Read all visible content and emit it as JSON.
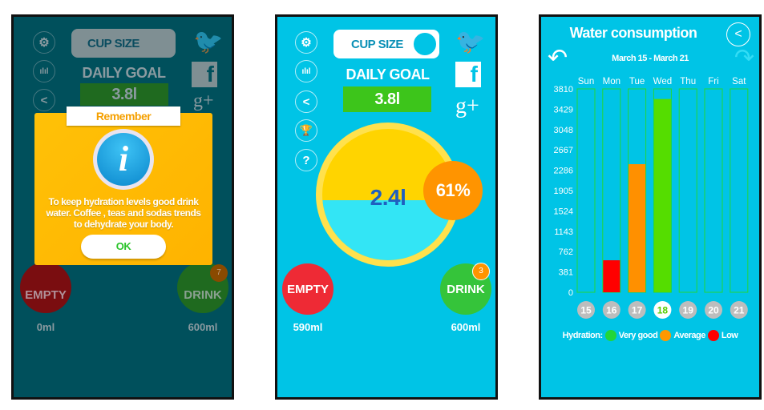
{
  "main_screen": {
    "cup_size_label": "CUP SIZE",
    "daily_goal_label": "DAILY GOAL",
    "daily_goal_value": "3.8l",
    "current_amount": "2.4l",
    "percent": "61%",
    "fill_percent": 61,
    "empty_label": "EMPTY",
    "empty_amount": "590ml",
    "drink_label": "DRINK",
    "drink_amount": "600ml",
    "drink_badge": "3",
    "side_icons": [
      "gear-icon",
      "stats-icon",
      "share-icon",
      "trophy-icon",
      "help-icon"
    ],
    "social": {
      "twitter": "twitter-icon",
      "facebook": "f",
      "google": "g+"
    }
  },
  "dialog_screen": {
    "cup_size_label": "CUP SIZE",
    "daily_goal_label": "DAILY GOAL",
    "daily_goal_value": "3.8l",
    "empty_label": "EMPTY",
    "empty_amount": "0ml",
    "drink_label": "DRINK",
    "drink_amount": "600ml",
    "drink_badge": "7",
    "dialog": {
      "title": "Remember",
      "message": "To keep hydration levels good drink water. Coffee , teas and sodas trends to dehydrate your body.",
      "ok_label": "OK"
    }
  },
  "stats_screen": {
    "title": "Water consumption",
    "date_range": "March 15 - March 21",
    "legend_label": "Hydration:",
    "legend": [
      {
        "label": "Very good",
        "color": "#22d63a"
      },
      {
        "label": "Average",
        "color": "#ff9800"
      },
      {
        "label": "Low",
        "color": "#ff0000"
      }
    ]
  },
  "chart_data": {
    "type": "bar",
    "categories": [
      "Sun",
      "Mon",
      "Tue",
      "Wed",
      "Thu",
      "Fri",
      "Sat"
    ],
    "dates": [
      "15",
      "16",
      "17",
      "18",
      "19",
      "20",
      "21"
    ],
    "selected_date": "18",
    "values": [
      0,
      600,
      2400,
      3620,
      0,
      0,
      0
    ],
    "bar_colors": [
      "#ff0000",
      "#ff0000",
      "#ff9000",
      "#55dd00",
      "#55dd00",
      "#55dd00",
      "#55dd00"
    ],
    "yticks": [
      0,
      381,
      762,
      1143,
      1524,
      1905,
      2286,
      2667,
      3048,
      3429,
      3810
    ],
    "ylim": [
      0,
      3810
    ]
  },
  "colors": {
    "background": "#00c4e6",
    "goal_green": "#3dc51b",
    "empty_red": "#ee2a35",
    "drink_green": "#35c43a",
    "percent_orange": "#ff9400"
  }
}
